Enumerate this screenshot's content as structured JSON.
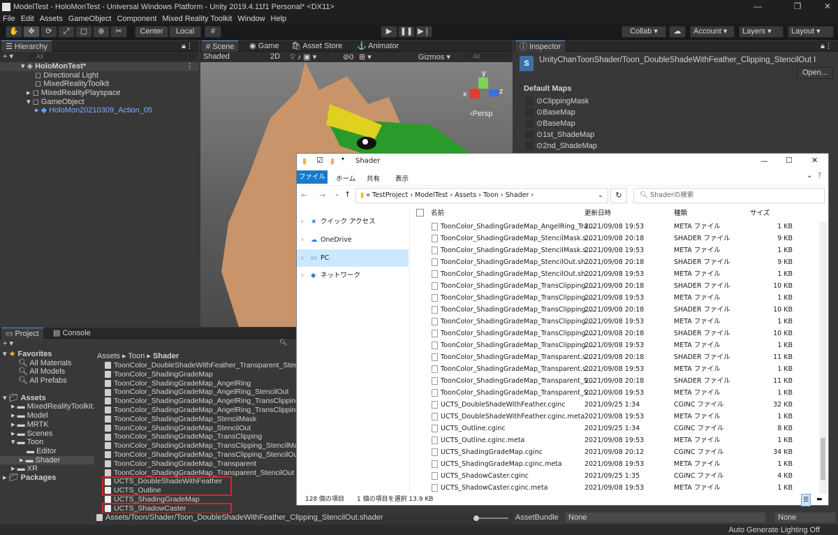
{
  "titlebar": {
    "title": "ModelTest - HoloMonTest - Universal Windows Platform - Unity 2019.4.11f1 Personal* <DX11>",
    "min": "—",
    "max": "❐",
    "close": "✕"
  },
  "menu": [
    "File",
    "Edit",
    "Assets",
    "GameObject",
    "Component",
    "Mixed Reality Toolkit",
    "Window",
    "Help"
  ],
  "toolbar": {
    "center": "Center",
    "local": "Local",
    "collab": "Collab ▾",
    "account": "Account",
    "layers": "Layers",
    "layout": "Layout"
  },
  "hierarchy": {
    "tab": "Hierarchy",
    "search_placeholder": "All",
    "scene": "HoloMonTest*",
    "items": [
      "Directional Light",
      "MixedRealityToolkit",
      "MixedRealityPlayspace",
      "GameObject",
      "HoloMon20210309_Action_05"
    ]
  },
  "scene": {
    "tabs": [
      "Scene",
      "Game",
      "Asset Store",
      "Animator"
    ],
    "shading": "Shaded",
    "mode2d": "2D",
    "gizmos": "Gizmos",
    "fxcount": "0",
    "search": "All",
    "persp": "‹Persp",
    "axis_x": "x",
    "axis_y": "y",
    "axis_z": "z"
  },
  "inspector": {
    "tab": "Inspector",
    "shader_name": "UnityChanToonShader/Toon_DoubleShadeWithFeather_Clipping_StencilOut I",
    "open": "Open...",
    "section": "Default Maps",
    "maps": [
      "ClippingMask",
      "BaseMap",
      "BaseMap",
      "1st_ShadeMap",
      "2nd_ShadeMap"
    ],
    "assetbundle_label": "AssetBundle",
    "assetbundle_value": "None",
    "assetbundle_variant": "None"
  },
  "project": {
    "tabs": [
      "Project",
      "Console"
    ],
    "favorites": "Favorites",
    "fav_items": [
      "All Materials",
      "All Models",
      "All Prefabs"
    ],
    "assets": "Assets",
    "asset_items": [
      "MixedRealityToolkit.",
      "Model",
      "MRTK",
      "Scenes",
      "Toon",
      "Editor",
      "Shader",
      "XR"
    ],
    "packages": "Packages",
    "breadcrumb": [
      "Assets",
      "Toon",
      "Shader"
    ],
    "files": [
      "ToonColor_DoubleShadeWithFeather_Transparent_Stenc",
      "ToonColor_ShadingGradeMap",
      "ToonColor_ShadingGradeMap_AngelRing",
      "ToonColor_ShadingGradeMap_AngelRing_StencilOut",
      "ToonColor_ShadingGradeMap_AngelRing_TransClipping",
      "ToonColor_ShadingGradeMap_AngelRing_TransClipping",
      "ToonColor_ShadingGradeMap_StencilMask",
      "ToonColor_ShadingGradeMap_StencilOut",
      "ToonColor_ShadingGradeMap_TransClipping",
      "ToonColor_ShadingGradeMap_TransClipping_StencilMa",
      "ToonColor_ShadingGradeMap_TransClipping_StencilOut",
      "ToonColor_ShadingGradeMap_Transparent",
      "ToonColor_ShadingGradeMap_Transparent_StencilOut",
      "UCTS_DoubleShadeWithFeather",
      "UCTS_Outline",
      "UCTS_ShadingGradeMap",
      "UCTS_ShadowCaster"
    ],
    "path": "Assets/Toon/Shader/Toon_DoubleShadeWithFeather_Clipping_StencilOut.shader"
  },
  "status": "Auto Generate Lighting Off",
  "explorer": {
    "title": "Shader",
    "ribbon": [
      "ファイル",
      "ホーム",
      "共有",
      "表示"
    ],
    "path": [
      "«",
      "TestProject",
      "ModelTest",
      "Assets",
      "Toon",
      "Shader"
    ],
    "search_placeholder": "Shaderの検索",
    "nav": [
      "クイック アクセス",
      "OneDrive",
      "PC",
      "ネットワーク"
    ],
    "cols": [
      "名前",
      "更新日時",
      "種類",
      "サイズ"
    ],
    "rows": [
      [
        "ToonColor_ShadingGradeMap_AngelRing_Tra...",
        "2021/09/08 19:53",
        "META ファイル",
        "1 KB"
      ],
      [
        "ToonColor_ShadingGradeMap_StencilMask.s...",
        "2021/09/08 20:18",
        "SHADER ファイル",
        "9 KB"
      ],
      [
        "ToonColor_ShadingGradeMap_StencilMask.s...",
        "2021/09/08 19:53",
        "META ファイル",
        "1 KB"
      ],
      [
        "ToonColor_ShadingGradeMap_StencilOut.sh...",
        "2021/09/08 20:18",
        "SHADER ファイル",
        "9 KB"
      ],
      [
        "ToonColor_ShadingGradeMap_StencilOut.sh...",
        "2021/09/08 19:53",
        "META ファイル",
        "1 KB"
      ],
      [
        "ToonColor_ShadingGradeMap_TransClipping....",
        "2021/09/08 20:18",
        "SHADER ファイル",
        "10 KB"
      ],
      [
        "ToonColor_ShadingGradeMap_TransClipping....",
        "2021/09/08 19:53",
        "META ファイル",
        "1 KB"
      ],
      [
        "ToonColor_ShadingGradeMap_TransClipping....",
        "2021/09/08 20:18",
        "SHADER ファイル",
        "10 KB"
      ],
      [
        "ToonColor_ShadingGradeMap_TransClipping....",
        "2021/09/08 19:53",
        "META ファイル",
        "1 KB"
      ],
      [
        "ToonColor_ShadingGradeMap_TransClipping....",
        "2021/09/08 20:18",
        "SHADER ファイル",
        "10 KB"
      ],
      [
        "ToonColor_ShadingGradeMap_TransClipping....",
        "2021/09/08 19:53",
        "META ファイル",
        "1 KB"
      ],
      [
        "ToonColor_ShadingGradeMap_Transparent.s...",
        "2021/09/08 20:18",
        "SHADER ファイル",
        "11 KB"
      ],
      [
        "ToonColor_ShadingGradeMap_Transparent.s...",
        "2021/09/08 19:53",
        "META ファイル",
        "1 KB"
      ],
      [
        "ToonColor_ShadingGradeMap_Transparent_S...",
        "2021/09/08 20:18",
        "SHADER ファイル",
        "11 KB"
      ],
      [
        "ToonColor_ShadingGradeMap_Transparent_S...",
        "2021/09/08 19:53",
        "META ファイル",
        "1 KB"
      ],
      [
        "UCTS_DoubleShadeWithFeather.cginc",
        "2021/09/25 1:34",
        "CGINC ファイル",
        "32 KB"
      ],
      [
        "UCTS_DoubleShadeWithFeather.cginc.meta",
        "2021/09/08 19:53",
        "META ファイル",
        "1 KB"
      ],
      [
        "UCTS_Outline.cginc",
        "2021/09/25 1:34",
        "CGINC ファイル",
        "8 KB"
      ],
      [
        "UCTS_Outline.cginc.meta",
        "2021/09/08 19:53",
        "META ファイル",
        "1 KB"
      ],
      [
        "UCTS_ShadingGradeMap.cginc",
        "2021/09/08 20:12",
        "CGINC ファイル",
        "34 KB"
      ],
      [
        "UCTS_ShadingGradeMap.cginc.meta",
        "2021/09/08 19:53",
        "META ファイル",
        "1 KB"
      ],
      [
        "UCTS_ShadowCaster.cginc",
        "2021/09/25 1:35",
        "CGINC ファイル",
        "4 KB"
      ],
      [
        "UCTS_ShadowCaster.cginc.meta",
        "2021/09/08 19:53",
        "META ファイル",
        "1 KB"
      ]
    ],
    "status_count": "128 個の項目",
    "status_sel": "1 個の項目を選択  13.9 KB"
  }
}
